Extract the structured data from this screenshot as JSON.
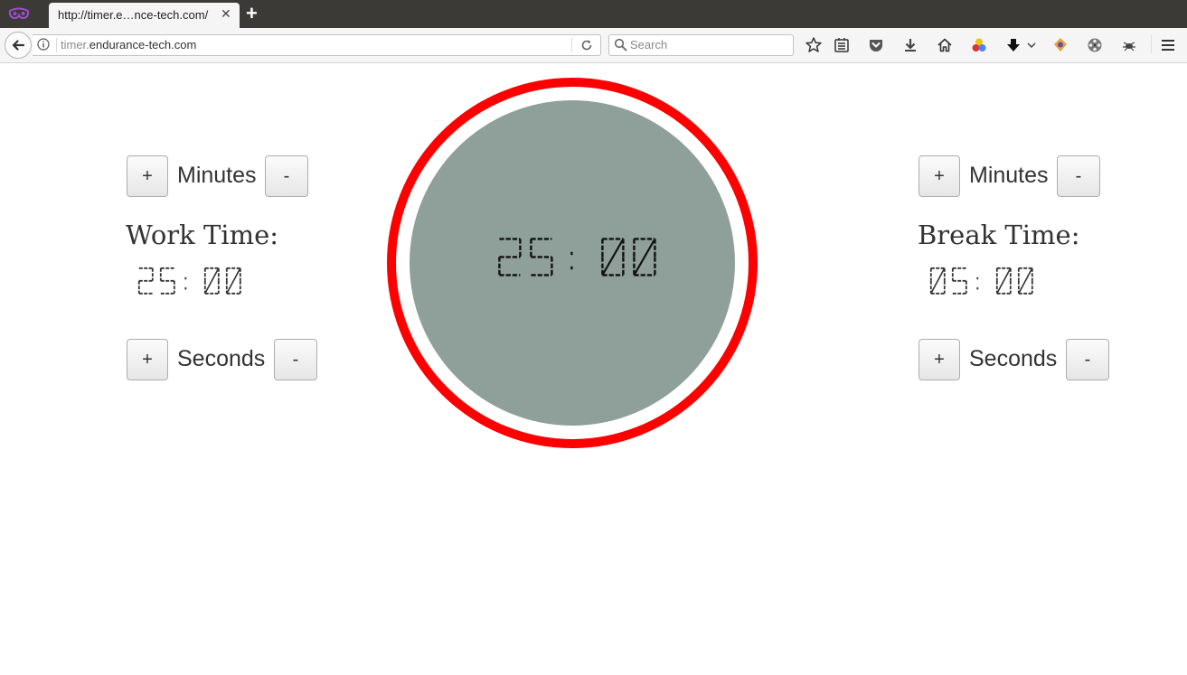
{
  "browser": {
    "tab_title": "http://timer.e…nce-tech.com/",
    "url_host_prefix": "timer.",
    "url_host": "endurance-tech.com",
    "search_placeholder": "Search",
    "toolbar_icons": [
      "bookmark-star-icon",
      "reading-list-icon",
      "pocket-icon",
      "download-icon",
      "home-icon",
      "colorful-extension-icon",
      "download-arrow-icon",
      "dropdown-arrow-icon",
      "puzzle-extension-icon",
      "film-reel-icon",
      "bug-extension-icon",
      "hamburger-menu-icon"
    ]
  },
  "timer": {
    "display": "25:00",
    "minutes": "25",
    "seconds": "00",
    "ring_color": "#ff0000",
    "face_color": "#8fa09a"
  },
  "work": {
    "title": "Work Time:",
    "minutes_label": "Minutes",
    "seconds_label": "Seconds",
    "plus": "+",
    "minus": "-",
    "minutes": "25",
    "seconds": "00"
  },
  "break": {
    "title": "Break Time:",
    "minutes_label": "Minutes",
    "seconds_label": "Seconds",
    "plus": "+",
    "minus": "-",
    "minutes": "05",
    "seconds": "00"
  }
}
